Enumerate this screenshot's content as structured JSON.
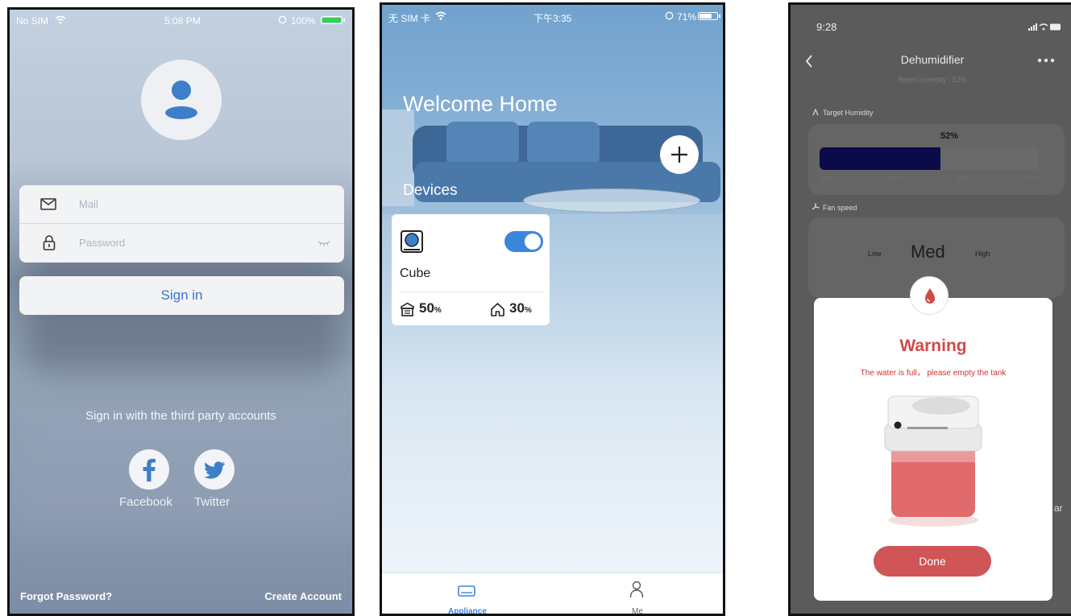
{
  "signin_screen": {
    "status": {
      "carrier": "No SIM",
      "time": "5:08 PM",
      "battery": "100%"
    },
    "mail_placeholder": "Mail",
    "password_placeholder": "Password",
    "sign_in_label": "Sign in",
    "third_party_text": "Sign in with the third party accounts",
    "facebook_label": "Facebook",
    "twitter_label": "Twitter",
    "forgot_password": "Forgot Password?",
    "create_account": "Create Account",
    "icons": [
      "user-icon",
      "mail-icon",
      "lock-icon",
      "eye-closed-icon",
      "facebook-icon",
      "twitter-icon"
    ]
  },
  "home_screen": {
    "status": {
      "carrier": "无 SIM 卡",
      "time": "下午3:35",
      "battery": "71%"
    },
    "welcome": "Welcome Home",
    "devices_label": "Devices",
    "device": {
      "name": "Cube",
      "power_on": true,
      "humidity_value": "50",
      "humidity_unit": "%",
      "room_value": "30",
      "room_unit": "%"
    },
    "tabs": {
      "appliance": "Appliance",
      "me": "Me"
    },
    "accent": "#3b86dd"
  },
  "dehumidifier_screen": {
    "status": {
      "time": "9:28"
    },
    "title": "Dehumidifier",
    "room_humidity": "Room humidity : 52%",
    "target_humidity_label": "Target Humidity",
    "target_value": "52%",
    "target_fraction": 0.52,
    "ticks": [
      "30%",
      "40%",
      "60%",
      "70%"
    ],
    "fan_speed_label": "Fan speed",
    "fan_low": "Low",
    "fan_med": "Med",
    "fan_high": "High",
    "side_fragment": "ar",
    "warning_title": "Warning",
    "warning_text": "The water is full， please empty the tank",
    "done_label": "Done",
    "warning_color": "#d04a4a"
  }
}
